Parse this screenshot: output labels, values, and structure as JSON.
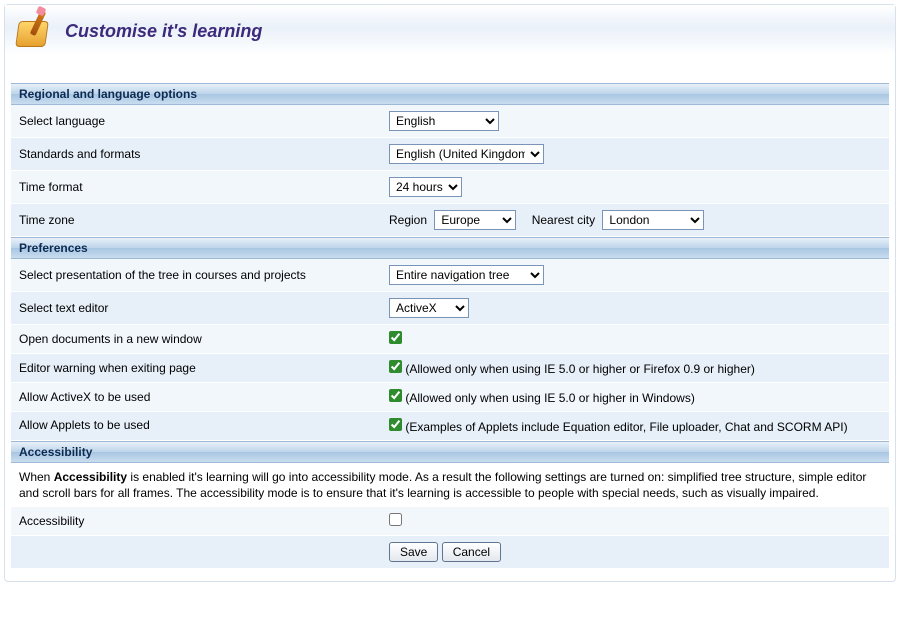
{
  "header": {
    "title": "Customise it's learning"
  },
  "sections": {
    "regional": {
      "title": "Regional and language options",
      "language_label": "Select language",
      "language_value": "English",
      "standards_label": "Standards and formats",
      "standards_value": "English (United Kingdom)",
      "timeformat_label": "Time format",
      "timeformat_value": "24 hours",
      "timezone_label": "Time zone",
      "region_label": "Region",
      "region_value": "Europe",
      "nearest_label": "Nearest city",
      "nearest_value": "London"
    },
    "preferences": {
      "title": "Preferences",
      "tree_label": "Select presentation of the tree in courses and projects",
      "tree_value": "Entire navigation tree",
      "editor_label": "Select text editor",
      "editor_value": "ActiveX",
      "open_new_label": "Open documents in a new window",
      "open_new_checked": true,
      "exit_warn_label": "Editor warning when exiting page",
      "exit_warn_checked": true,
      "exit_warn_note": "(Allowed only when using IE 5.0 or higher or Firefox 0.9 or higher)",
      "activex_label": "Allow ActiveX to be used",
      "activex_checked": true,
      "activex_note": "(Allowed only when using IE 5.0 or higher in Windows)",
      "applets_label": "Allow Applets to be used",
      "applets_checked": true,
      "applets_note": "(Examples of Applets include Equation editor, File uploader, Chat and SCORM API)"
    },
    "accessibility": {
      "title": "Accessibility",
      "description_pre": "When ",
      "description_bold": "Accessibility",
      "description_post": " is enabled it's learning will go into accessibility mode. As a result the following settings are turned on: simplified tree structure, simple editor and scroll bars for all frames. The accessibility mode is to ensure that it's learning is accessible to people with special needs, such as visually impaired.",
      "checkbox_label": "Accessibility",
      "checkbox_checked": false
    }
  },
  "buttons": {
    "save": "Save",
    "cancel": "Cancel"
  }
}
